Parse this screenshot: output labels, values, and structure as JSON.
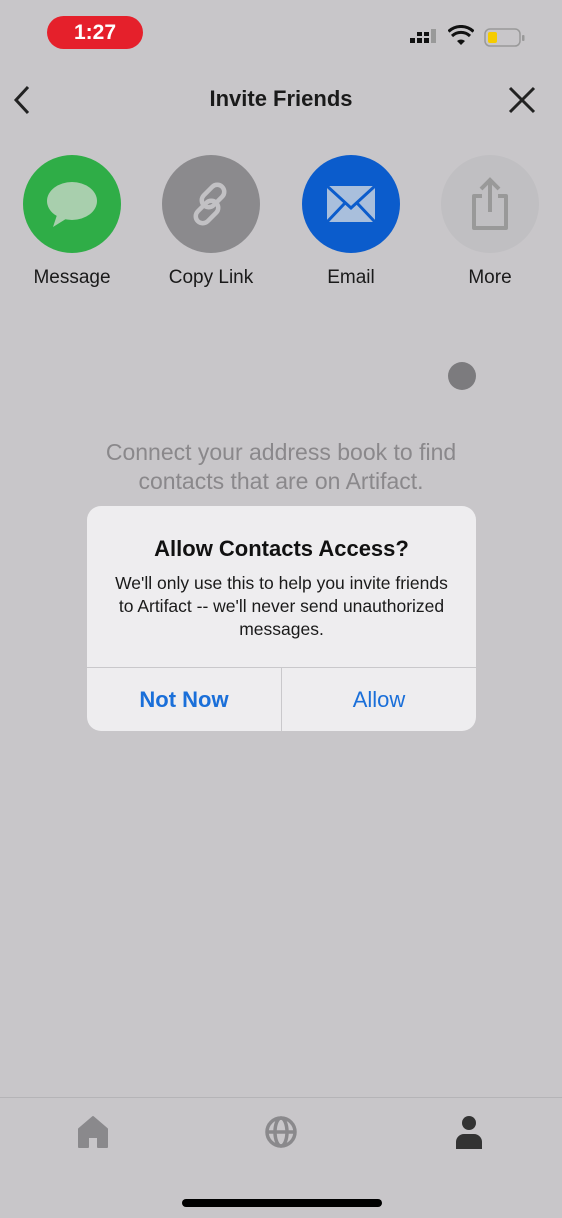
{
  "status_bar": {
    "time": "1:27",
    "battery_color": "#f5cc00"
  },
  "header": {
    "title": "Invite Friends",
    "back_icon": "chevron-left-icon",
    "close_icon": "close-icon"
  },
  "share_options": [
    {
      "label": "Message",
      "icon": "message-bubble-icon",
      "color": "#2fad47"
    },
    {
      "label": "Copy Link",
      "icon": "link-icon",
      "color": "#8b8a8d"
    },
    {
      "label": "Email",
      "icon": "envelope-icon",
      "color": "#0b5ccc"
    },
    {
      "label": "More",
      "icon": "share-icon",
      "color": "#c0bfc2"
    }
  ],
  "background_message": "Connect your address book to find contacts that are on Artifact.",
  "alert": {
    "title": "Allow Contacts Access?",
    "message": "We'll only use this to help you invite friends to Artifact -- we'll never send unauthorized messages.",
    "buttons": {
      "not_now": "Not Now",
      "allow": "Allow"
    },
    "button_color": "#1a6fd9"
  },
  "tab_bar": {
    "tabs": [
      {
        "icon": "home-icon"
      },
      {
        "icon": "globe-icon"
      },
      {
        "icon": "profile-icon",
        "active": true
      }
    ]
  }
}
